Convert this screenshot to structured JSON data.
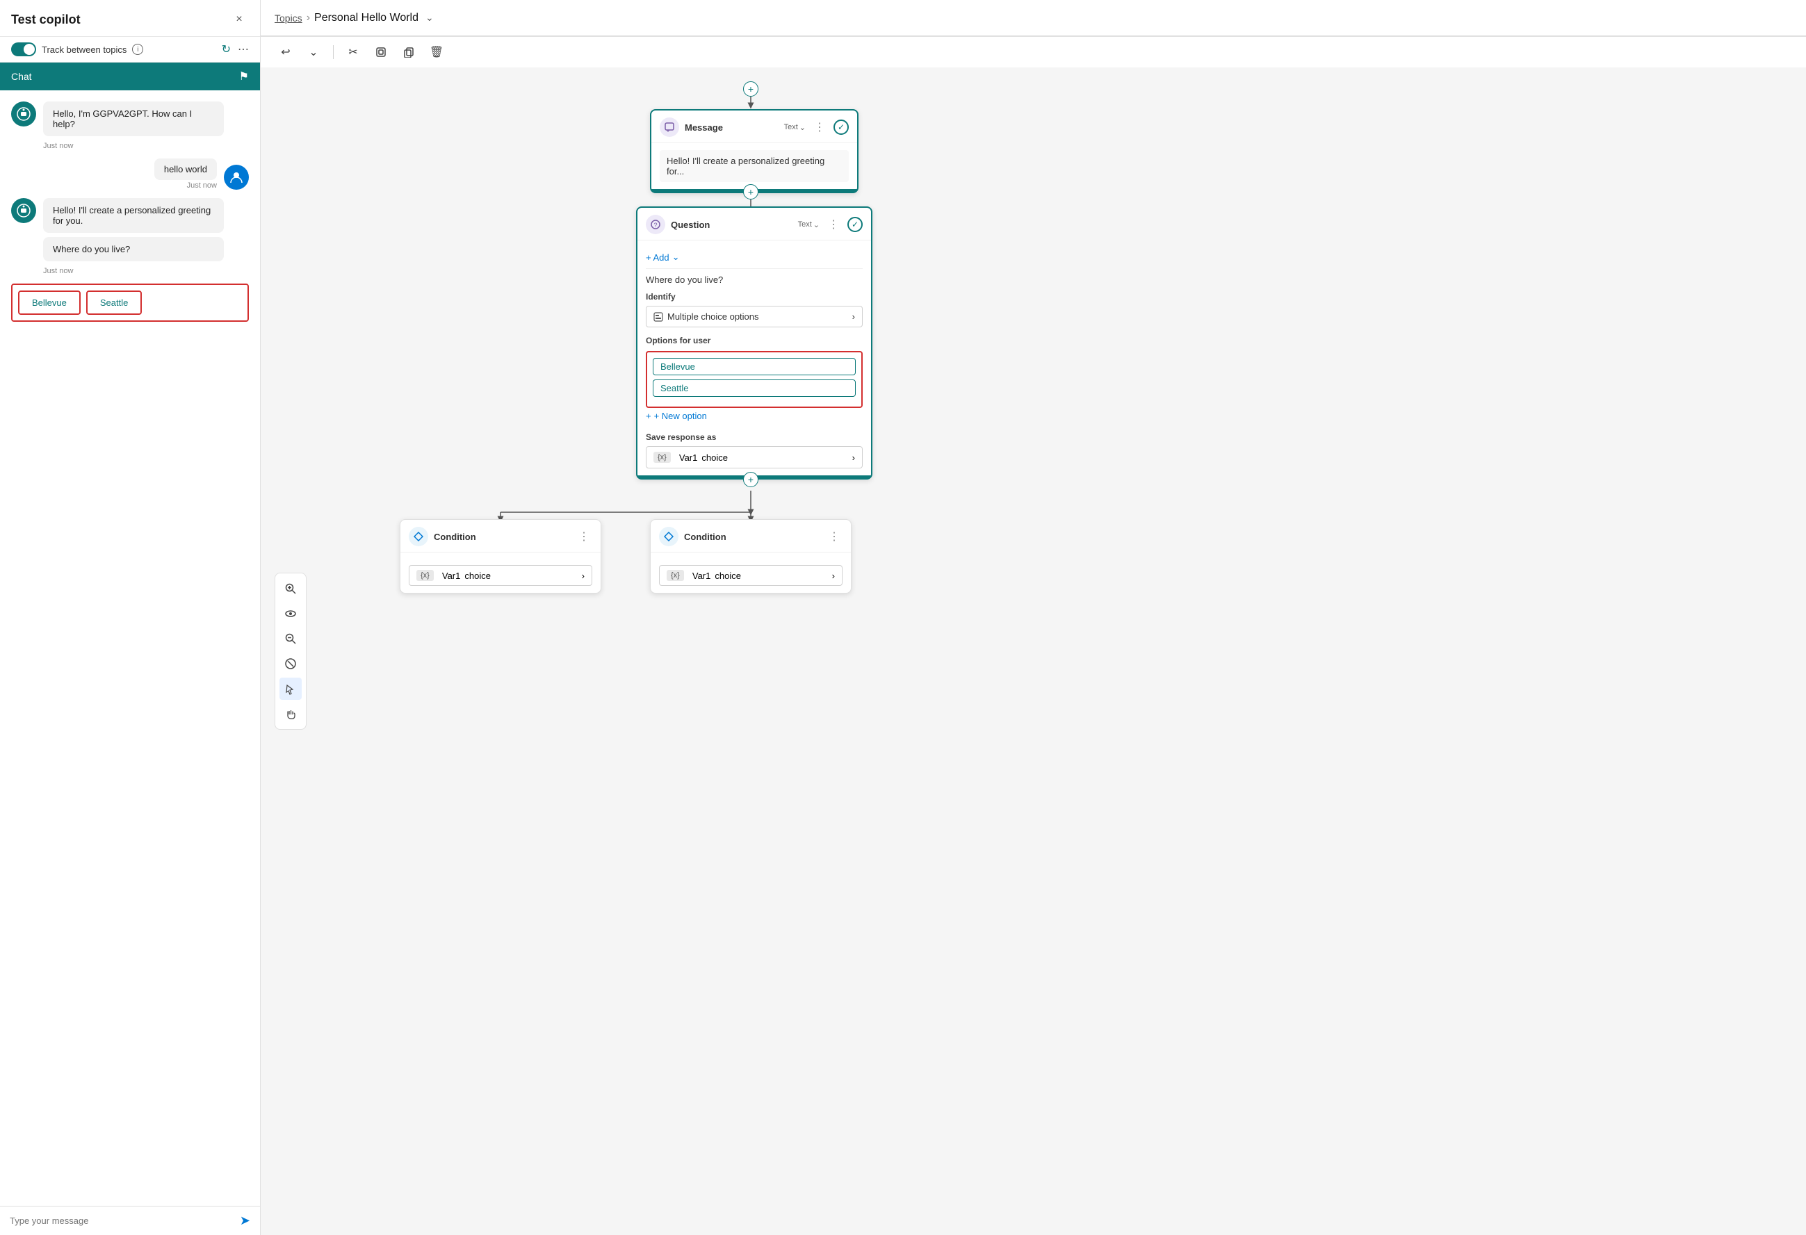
{
  "app": {
    "title": "Test copilot",
    "close_label": "×"
  },
  "toggle": {
    "label": "Track between topics",
    "enabled": true
  },
  "chat": {
    "tab_label": "Chat",
    "messages": [
      {
        "type": "bot",
        "text": "Hello, I'm GGPVA2GPT. How can I help?",
        "timestamp": "Just now"
      },
      {
        "type": "user",
        "text": "hello world",
        "timestamp": "Just now"
      },
      {
        "type": "bot",
        "texts": [
          "Hello! I'll create a personalized greeting for you.",
          "Where do you live?"
        ],
        "timestamp": "Just now"
      }
    ],
    "options": [
      "Bellevue",
      "Seattle"
    ],
    "input_placeholder": "Type your message"
  },
  "breadcrumb": {
    "topics_label": "Topics",
    "separator": "›",
    "current": "Personal Hello World"
  },
  "toolbar": {
    "buttons": [
      "↩",
      "⌄",
      "✂",
      "⬚",
      "⎘",
      "🗑"
    ]
  },
  "flow": {
    "message_node": {
      "title": "Message",
      "type": "Text",
      "text": "Hello! I'll create a personalized greeting for..."
    },
    "question_node": {
      "title": "Question",
      "type": "Text",
      "add_label": "+ Add",
      "question_text": "Where do you live?",
      "identify_label": "Identify",
      "identify_value": "Multiple choice options",
      "options_label": "Options for user",
      "options": [
        "Bellevue",
        "Seattle"
      ],
      "new_option_label": "+ New option",
      "save_label": "Save response as",
      "var_badge": "{x}",
      "var_name": "Var1",
      "var_type": "choice"
    },
    "condition_left": {
      "title": "Condition",
      "var_badge": "{x}",
      "var_name": "Var1",
      "var_type": "choice"
    },
    "condition_right": {
      "title": "Condition",
      "var_badge": "{x}",
      "var_name": "Var1",
      "var_type": "choice"
    }
  },
  "canvas_tools": [
    "🔍+",
    "👁",
    "🔍-",
    "⊘",
    "↖",
    "✋"
  ]
}
